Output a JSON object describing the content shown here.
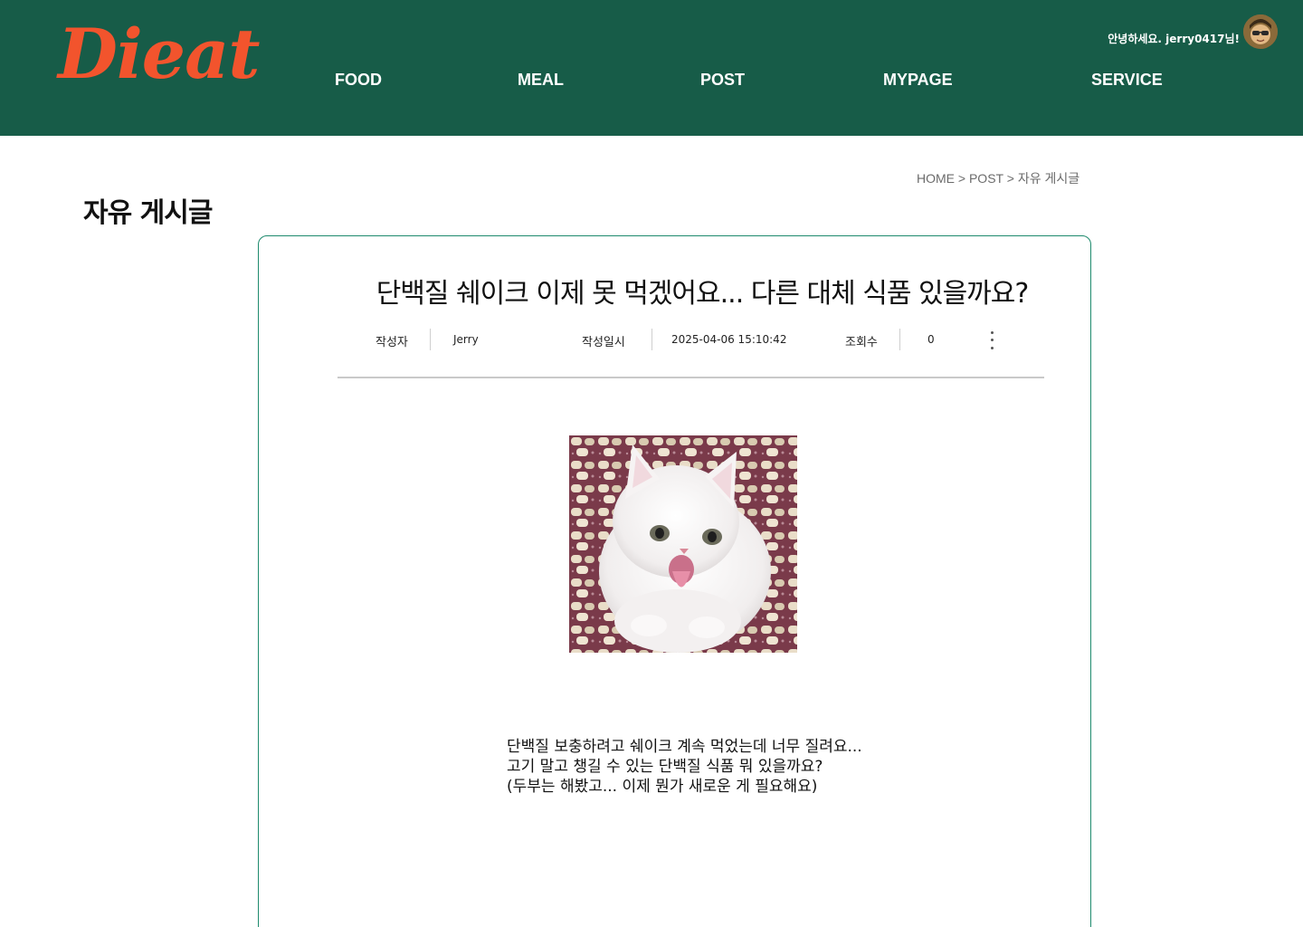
{
  "header": {
    "logo": "Dieat",
    "nav": [
      "FOOD",
      "MEAL",
      "POST",
      "MYPAGE",
      "SERVICE"
    ],
    "greeting": "안녕하세요. jerry0417님!"
  },
  "breadcrumb": [
    "HOME",
    "POST",
    "자유 게시글"
  ],
  "breadcrumb_separator": " > ",
  "page_title": "자유 게시글",
  "post": {
    "title": "단백질 쉐이크 이제 못 먹겠어요... 다른 대체 식품 있을까요?",
    "meta": {
      "author_label": "작성자",
      "author": "Jerry",
      "date_label": "작성일시",
      "date": "2025-04-06 15:10:42",
      "views_label": "조회수",
      "views": "0"
    },
    "body": [
      "단백질 보충하려고 쉐이크 계속 먹었는데 너무 질려요...",
      " 고기 말고 챙길 수 있는 단백질 식품 뭐 있을까요?",
      " (두부는 해봤고... 이제 뭔가 새로운 게 필요해요)"
    ]
  },
  "colors": {
    "header_bg": "#175c48",
    "logo": "#f2542d",
    "card_border": "#1e8a6d"
  },
  "icons": {
    "more": "more-vertical-icon",
    "avatar": "user-avatar"
  }
}
